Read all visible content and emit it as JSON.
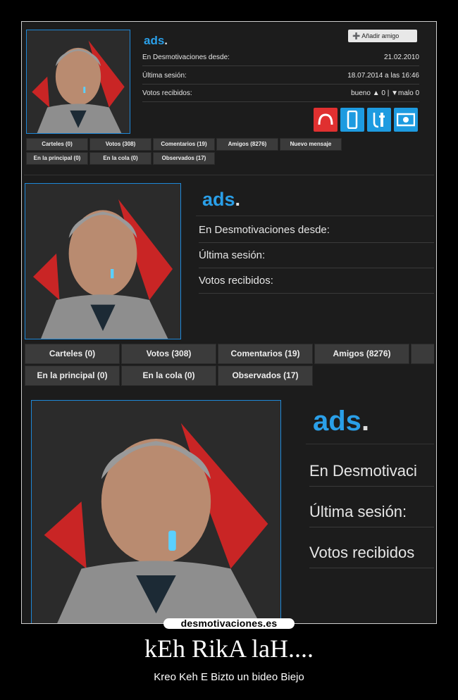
{
  "profile": {
    "username": "ads",
    "dot": ".",
    "add_friend": "Añadir amigo",
    "rows": [
      {
        "label": "En Desmotivaciones desde:",
        "value": "21.02.2010"
      },
      {
        "label": "Última sesión:",
        "value": "18.07.2014 a las 16:46"
      },
      {
        "label": "Votos recibidos:",
        "value": "bueno ▲ 0 | ▼malo 0"
      }
    ],
    "rows_short": [
      {
        "label": "En Desmotivaciones desde:"
      },
      {
        "label": "Última sesión:"
      },
      {
        "label": "Votos recibidos:"
      }
    ],
    "rows_large": [
      {
        "label": "En Desmotivaci"
      },
      {
        "label": "Última sesión:"
      },
      {
        "label": "Votos recibidos"
      }
    ],
    "tabs_row1": [
      "Carteles (0)",
      "Votos (308)",
      "Comentarios (19)",
      "Amigos (8276)",
      "Nuevo mensaje"
    ],
    "tabs_row2": [
      "En la principal (0)",
      "En la cola (0)",
      "Observados (17)"
    ],
    "icon_colors": [
      "#e03030",
      "#1e9be0",
      "#1e9be0",
      "#1e9be0"
    ]
  },
  "footer": {
    "site": "desmotivaciones.es",
    "title": "kEh RikA laH....",
    "subtitle": "Kreo Keh E Bizto un bideo Biejo"
  }
}
